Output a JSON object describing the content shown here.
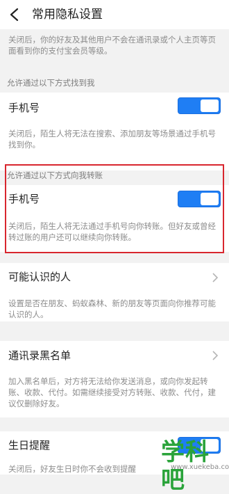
{
  "header": {
    "title": "常用隐私设置",
    "back_icon": "back-arrow-icon"
  },
  "top_note": "关闭后，你的好友及其他用户不会在通讯录或个人主页等页面看到你的支付宝会员等级。",
  "section_find_me": {
    "header": "允许通过以下方式找到我",
    "item_label": "手机号",
    "toggle_on": true,
    "note": "关闭后，陌生人将无法在搜索、添加朋友等场景通过手机号找到你。"
  },
  "section_transfer": {
    "header": "允许通过以下方式向我转账",
    "item_label": "手机号",
    "toggle_on": true,
    "note": "关闭后，陌生人将无法通过手机号向你转账。但好友或曾经转过账的用户还可以继续向你转账。"
  },
  "people_you_may_know": {
    "label": "可能认识的人",
    "note": "设置是否在朋友、蚂蚁森林、新的朋友等页面向你推荐可能认识的人。"
  },
  "contacts_blacklist": {
    "label": "通讯录黑名单",
    "note": "加入黑名单后，对方将无法给你发送消息，或向你发起转账、收款、代付。如需继续接受对方转账、收款、代付，建议仅删除好友。"
  },
  "birthday_reminder": {
    "label": "生日提醒",
    "toggle_on": true,
    "note": "关闭后，好友生日时你不会收到提醒"
  },
  "watermark": {
    "text": "学科吧",
    "url": "www.xuekeba.com"
  },
  "colors": {
    "accent": "#1f7ef4",
    "highlight_border": "#d8262e",
    "watermark": "#2aa33a"
  }
}
